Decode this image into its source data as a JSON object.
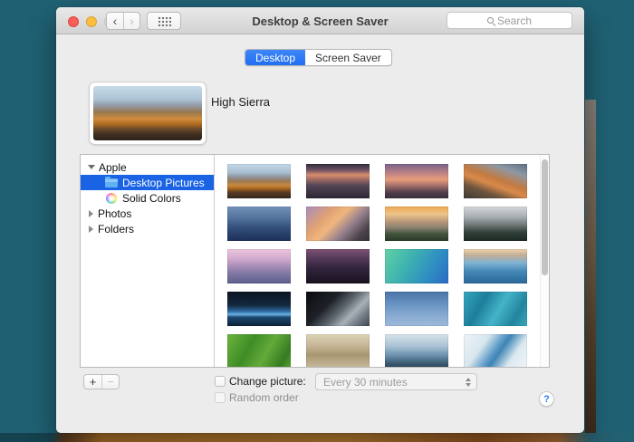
{
  "window": {
    "title": "Desktop & Screen Saver"
  },
  "toolbar": {
    "search_placeholder": "Search"
  },
  "tabs": {
    "desktop": "Desktop",
    "screen_saver": "Screen Saver"
  },
  "preview": {
    "title": "High Sierra"
  },
  "sidebar": {
    "items": [
      {
        "label": "Apple"
      },
      {
        "label": "Desktop Pictures"
      },
      {
        "label": "Solid Colors"
      },
      {
        "label": "Photos"
      },
      {
        "label": "Folders"
      }
    ]
  },
  "grid": {
    "items": [
      {
        "name": "high-sierra",
        "gradient": "linear-gradient(180deg,#c2d8e8 0%,#a9bfd2 25%,#8f939c 38%,#9c7a55 50%,#c98a3e 62%,#a8641f 72%,#5a3c22 82%,#33271c 100%)"
      },
      {
        "name": "sierra",
        "gradient": "linear-gradient(180deg,#332c3e 0%,#6e5262 18%,#d98d6c 32%,#a06a62 45%,#544656 62%,#2b2533 100%)"
      },
      {
        "name": "sierra-2",
        "gradient": "linear-gradient(180deg,#7a6288 0%,#b97f86 25%,#e89d7b 45%,#9c6a68 65%,#533f4c 82%,#3a2f3c 100%)"
      },
      {
        "name": "el-capitan",
        "gradient": "linear-gradient(200deg,#5d6d80 0%,#8d98a4 22%,#c27a42 45%,#d98a4a 58%,#6e553f 75%,#3e3a35 100%)"
      },
      {
        "name": "yosemite-blue",
        "gradient": "linear-gradient(180deg,#7492b8 0%,#51719c 35%,#33517c 60%,#1c3058 100%)"
      },
      {
        "name": "half-dome-sunset",
        "gradient": "linear-gradient(135deg,#a98cc0 0%,#e0a273 30%,#f0b67e 45%,#94808e 65%,#4a4248 85%,#332e36 100%)"
      },
      {
        "name": "yosemite-day",
        "gradient": "linear-gradient(180deg,#eda74f 0%,#edc489 22%,#b49578 45%,#8d8472 60%,#41523c 80%,#2b3a2a 100%)"
      },
      {
        "name": "foggy-forest",
        "gradient": "linear-gradient(180deg,#d3d7da 0%,#a8adb2 30%,#6b7472 55%,#31403a 75%,#1c2822 100%)"
      },
      {
        "name": "yosemite-pink",
        "gradient": "linear-gradient(180deg,#edc6dd 0%,#cfa8ce 30%,#9d87b2 55%,#7a74a0 75%,#5d5f8c 100%)"
      },
      {
        "name": "night-shore",
        "gradient": "linear-gradient(180deg,#7e5276 0%,#503756 30%,#32243c 55%,#181220 100%)"
      },
      {
        "name": "green-wave",
        "gradient": "linear-gradient(120deg,#62d0a6 0%,#3fb4ae 35%,#2f8ec2 70%,#2b6ac4 100%)"
      },
      {
        "name": "blue-wave",
        "gradient": "linear-gradient(180deg,#ecd5ac 0%,#c3ad95 18%,#7fb3d2 40%,#4387b6 65%,#2a6796 100%)"
      },
      {
        "name": "earth-space",
        "gradient": "linear-gradient(180deg,#0a1422 0%,#13293e 40%,#2f6da6 58%,#6db4e4 66%,#1d4a72 74%,#0b2238 100%)"
      },
      {
        "name": "planet-horizon",
        "gradient": "linear-gradient(135deg,#0b0b10 0%,#1d2127 35%,#5f6870 55%,#a8b0b8 70%,#6c7680 85%,#3f464e 100%)"
      },
      {
        "name": "milky-way",
        "gradient": "linear-gradient(180deg,#4a74a8 0%,#6c96c4 40%,#88abd2 70%,#9cbada 100%)"
      },
      {
        "name": "turquoise-sea",
        "gradient": "linear-gradient(120deg,#35a6bd 0%,#1d7e9c 30%,#44b4c8 55%,#23849e 80%,#3aa8bc 100%)"
      },
      {
        "name": "green-fields",
        "gradient": "linear-gradient(120deg,#6cb43e 0%,#3f8c26 35%,#63aa3a 60%,#357c22 85%,#58a232 100%)"
      },
      {
        "name": "desert-fog",
        "gradient": "linear-gradient(180deg,#ddd3b6 0%,#c4b494 35%,#a89670 60%,#cabda0 100%)"
      },
      {
        "name": "misty-ridges",
        "gradient": "linear-gradient(180deg,#d6e2ea 0%,#a9c2d4 35%,#6e94b0 60%,#3a5a72 85%,#27404f 100%)"
      },
      {
        "name": "snow-river",
        "gradient": "linear-gradient(125deg,#eef4f8 0%,#d7e6ee 30%,#5f9cc8 48%,#3d84b4 55%,#dce9f0 75%,#f0f5f8 100%)"
      }
    ]
  },
  "footer": {
    "add_label": "+",
    "remove_label": "−",
    "change_picture_label": "Change picture:",
    "interval_value": "Every 30 minutes",
    "random_order_label": "Random order",
    "help_label": "?"
  },
  "nav": {
    "back": "‹",
    "forward": "›"
  },
  "colors": {
    "tab_active_blue": "#2f7cf6",
    "selection_blue": "#1a63e4",
    "folder_blue": "#5fb0f5"
  }
}
